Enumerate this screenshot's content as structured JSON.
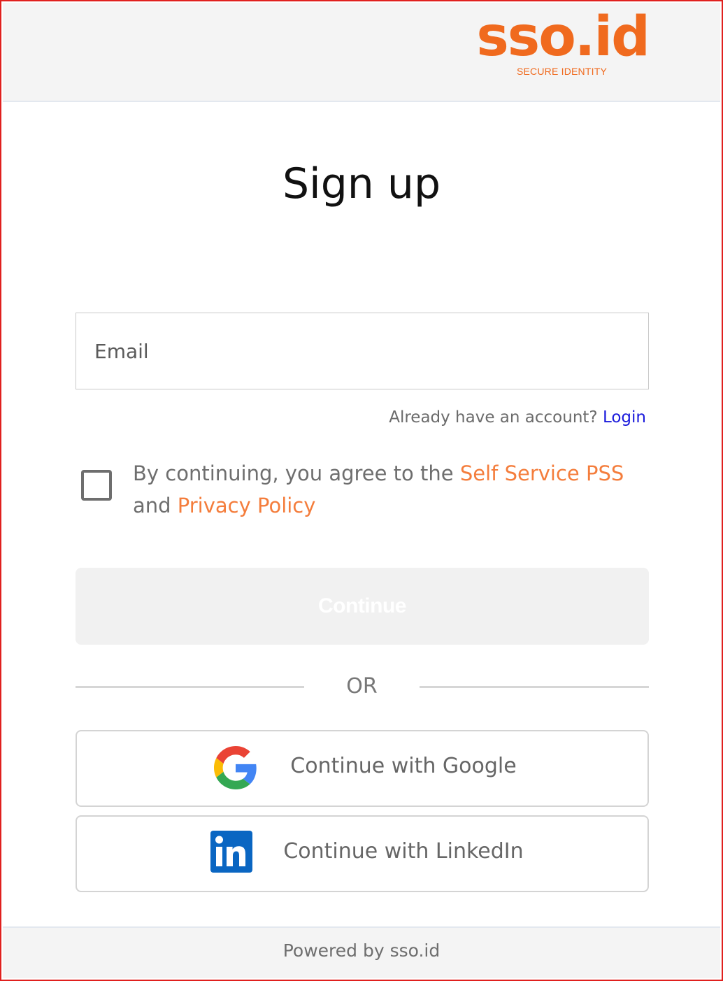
{
  "header": {
    "logo_text": "sso.id",
    "logo_tagline": "SECURE IDENTITY"
  },
  "title": "Sign up",
  "form": {
    "email_placeholder": "Email",
    "email_value": "",
    "login_prompt": "Already have an account?",
    "login_link": "Login",
    "agree_prefix": "By continuing, you agree to the",
    "agree_link_terms": "Self Service PSS",
    "agree_middle": "and",
    "agree_link_privacy": "Privacy Policy",
    "checkbox_checked": false,
    "continue_label": "Continue"
  },
  "divider_label": "OR",
  "social": {
    "google_label": "Continue with Google",
    "linkedin_label": "Continue with LinkedIn"
  },
  "footer": {
    "text": "Powered by sso.id"
  },
  "colors": {
    "brand": "#f06a1e",
    "link_orange": "#f47d3c",
    "link_blue": "#1a1adc",
    "window_border": "#e0201e"
  }
}
